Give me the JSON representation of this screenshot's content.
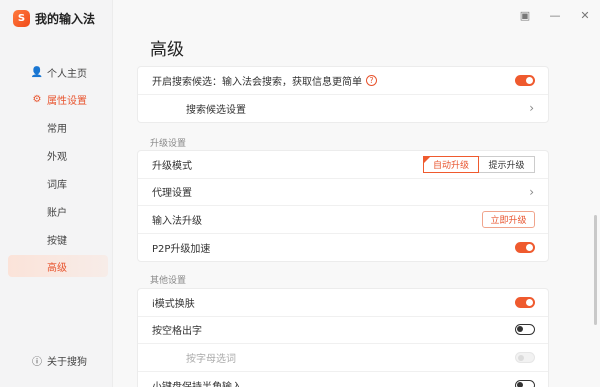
{
  "app": {
    "logo_char": "S",
    "name": "我的输入法"
  },
  "window_controls": {
    "feedback_icon": "▣",
    "minimize_icon": "—",
    "close_icon": "✕"
  },
  "sidebar": {
    "profile": {
      "icon": "user-icon",
      "label": "个人主页"
    },
    "properties": {
      "icon": "gear-icon",
      "label": "属性设置"
    },
    "sub_items": [
      "常用",
      "外观",
      "词库",
      "账户",
      "按键",
      "高级"
    ],
    "active_sub": "高级",
    "about": {
      "icon": "info-icon",
      "label": "关于搜狗"
    }
  },
  "page_title": "高级",
  "search_card": {
    "row1": {
      "label": "开启搜索候选：输入法会搜索，获取信息更简单",
      "help": "?",
      "toggle": "on"
    },
    "row2": {
      "label": "搜索候选设置",
      "chevron": "›"
    }
  },
  "upgrade_section": {
    "title": "升级设置",
    "rows": {
      "mode": {
        "label": "升级模式",
        "options": [
          "自动升级",
          "提示升级"
        ],
        "selected": "自动升级"
      },
      "proxy": {
        "label": "代理设置",
        "chevron": "›"
      },
      "ime_upgrade": {
        "label": "输入法升级",
        "button": "立即升级"
      },
      "p2p": {
        "label": "P2P升级加速",
        "toggle": "on"
      }
    }
  },
  "other_section": {
    "title": "其他设置",
    "rows": {
      "imode": {
        "label": "i模式换肤",
        "toggle": "on"
      },
      "space": {
        "label": "按空格出字",
        "toggle": "off"
      },
      "letter": {
        "label": "按字母选词",
        "toggle": "disabled"
      },
      "keyboard": {
        "label": "小键盘保持半角输入",
        "toggle": "off"
      }
    }
  },
  "colors": {
    "accent": "#ef5a2e",
    "sidebar_bg": "#f4f4f5",
    "content_bg": "#f8f8f8"
  }
}
